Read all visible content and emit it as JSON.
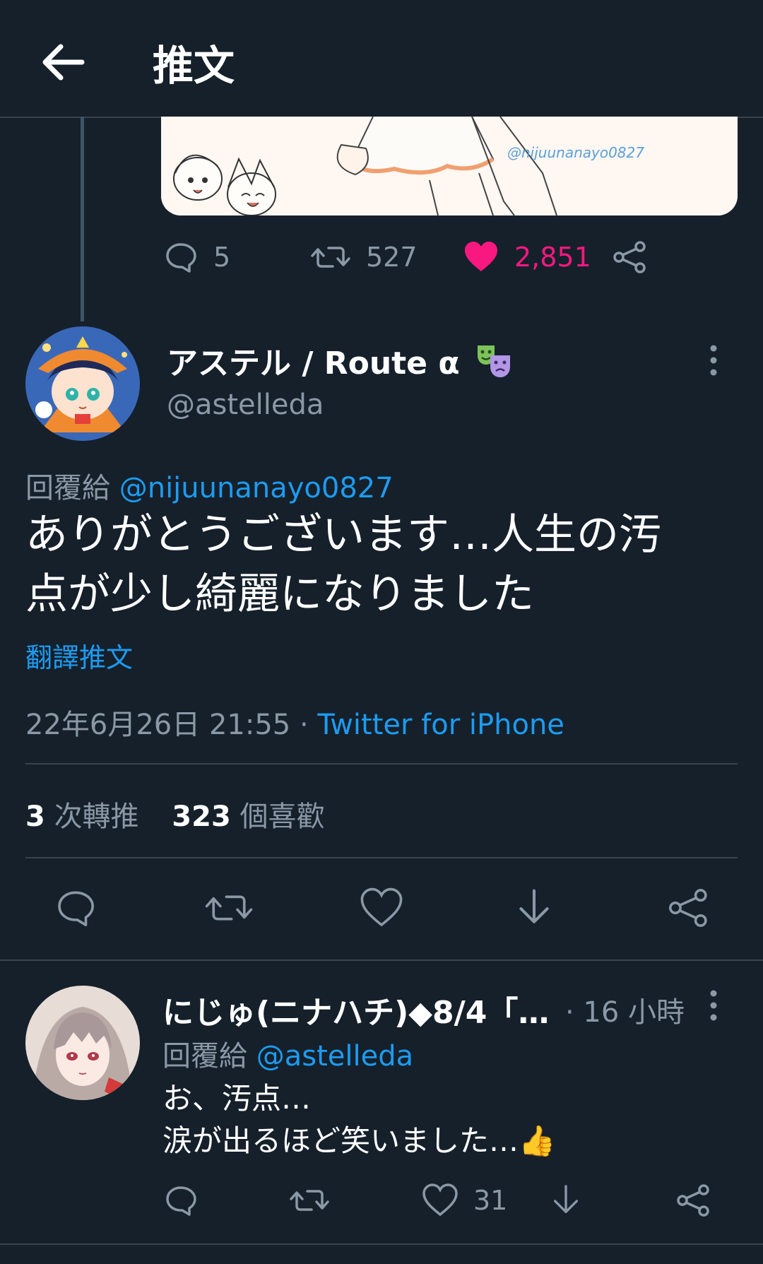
{
  "header": {
    "title": "推文",
    "back_icon": "arrow-left-icon"
  },
  "parent_tweet": {
    "image_watermark": "@nijuunanayo0827",
    "actions": {
      "replies": "5",
      "retweets": "527",
      "likes": "2,851"
    },
    "like_color": "#f91880"
  },
  "main_tweet": {
    "display_name": "アステル / Route α",
    "handle": "@astelleda",
    "reply_to_label": "回覆給",
    "reply_to_handle": "@nijuunanayo0827",
    "text_line1": "ありがとうございます…人生の汚",
    "text_line2": "点が少し綺麗になりました",
    "translate_label": "翻譯推文",
    "timestamp": "22年6月26日 21:55",
    "separator": " · ",
    "source": "Twitter for iPhone",
    "retweet_count": "3",
    "retweet_label": "次轉推",
    "like_count": "323",
    "like_label": "個喜歡"
  },
  "reply_tweet": {
    "display_name": "にじゅ(ニナハチ)◆8/4「…",
    "time": "· 16 小時",
    "reply_to_label": "回覆給",
    "reply_to_handle": "@astelleda",
    "text_line1": "お、汚点…",
    "text_line2": "涙が出るほど笑いました…👍",
    "like_count": "31"
  },
  "colors": {
    "background": "#15202b",
    "accent": "#1d9bf0",
    "muted": "#8b98a5",
    "divider": "#38444d"
  }
}
